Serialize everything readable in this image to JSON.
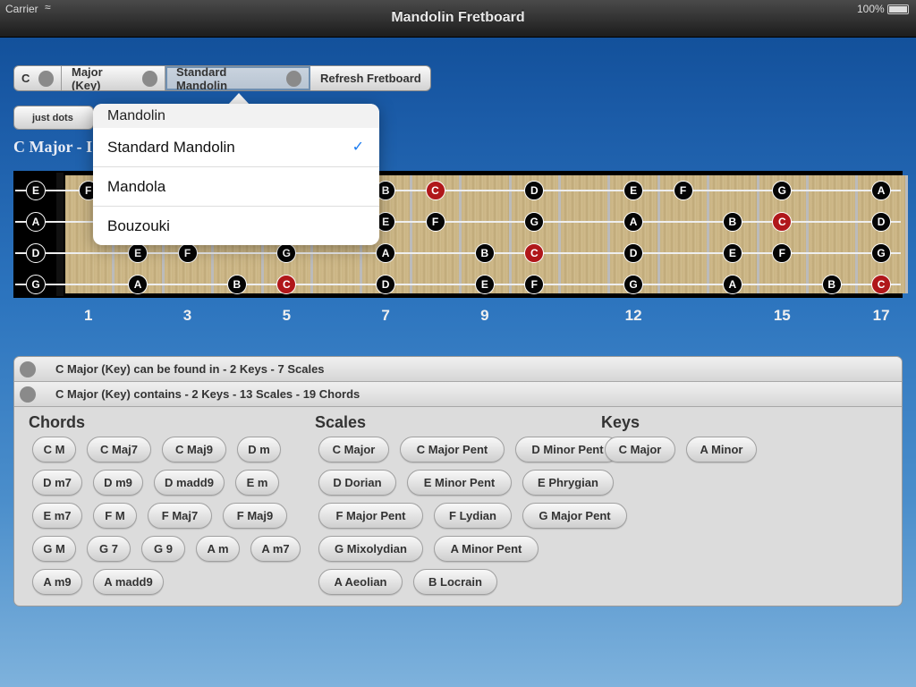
{
  "status": {
    "carrier": "Carrier",
    "battery": "100%"
  },
  "nav": {
    "title": "Mandolin Fretboard"
  },
  "toolbar": {
    "key": "C",
    "mode": "Major (Key)",
    "instrument": "Standard Mandolin",
    "refresh": "Refresh Fretboard",
    "just_dots": "just dots"
  },
  "heading": "C Major - I",
  "strings": [
    "E",
    "A",
    "D",
    "G"
  ],
  "fret_numbers": [
    "1",
    "3",
    "5",
    "7",
    "9",
    "12",
    "15",
    "17"
  ],
  "fretboard_notes": {
    "E": [
      {
        "fret": 1,
        "note": "F",
        "root": false
      },
      {
        "fret": 7,
        "note": "B",
        "root": false
      },
      {
        "fret": 8,
        "note": "C",
        "root": true
      },
      {
        "fret": 10,
        "note": "D",
        "root": false
      },
      {
        "fret": 12,
        "note": "E",
        "root": false
      },
      {
        "fret": 13,
        "note": "F",
        "root": false
      },
      {
        "fret": 15,
        "note": "G",
        "root": false
      },
      {
        "fret": 17,
        "note": "A",
        "root": false
      }
    ],
    "A": [
      {
        "fret": 7,
        "note": "E",
        "root": false
      },
      {
        "fret": 8,
        "note": "F",
        "root": false
      },
      {
        "fret": 10,
        "note": "G",
        "root": false
      },
      {
        "fret": 12,
        "note": "A",
        "root": false
      },
      {
        "fret": 14,
        "note": "B",
        "root": false
      },
      {
        "fret": 15,
        "note": "C",
        "root": true
      },
      {
        "fret": 17,
        "note": "D",
        "root": false
      }
    ],
    "D": [
      {
        "fret": 2,
        "note": "E",
        "root": false
      },
      {
        "fret": 3,
        "note": "F",
        "root": false
      },
      {
        "fret": 5,
        "note": "G",
        "root": false
      },
      {
        "fret": 7,
        "note": "A",
        "root": false
      },
      {
        "fret": 9,
        "note": "B",
        "root": false
      },
      {
        "fret": 10,
        "note": "C",
        "root": true
      },
      {
        "fret": 12,
        "note": "D",
        "root": false
      },
      {
        "fret": 14,
        "note": "E",
        "root": false
      },
      {
        "fret": 15,
        "note": "F",
        "root": false
      },
      {
        "fret": 17,
        "note": "G",
        "root": false
      }
    ],
    "G": [
      {
        "fret": 2,
        "note": "A",
        "root": false
      },
      {
        "fret": 4,
        "note": "B",
        "root": false
      },
      {
        "fret": 5,
        "note": "C",
        "root": true
      },
      {
        "fret": 7,
        "note": "D",
        "root": false
      },
      {
        "fret": 9,
        "note": "E",
        "root": false
      },
      {
        "fret": 10,
        "note": "F",
        "root": false
      },
      {
        "fret": 12,
        "note": "G",
        "root": false
      },
      {
        "fret": 14,
        "note": "A",
        "root": false
      },
      {
        "fret": 16,
        "note": "B",
        "root": false
      },
      {
        "fret": 17,
        "note": "C",
        "root": true
      }
    ]
  },
  "panel": {
    "row1": "C Major (Key) can be found in - 2 Keys - 7 Scales",
    "row2": "C Major (Key) contains - 2 Keys - 13 Scales - 19 Chords",
    "chords_title": "Chords",
    "scales_title": "Scales",
    "keys_title": "Keys",
    "chords": [
      [
        "C M",
        "C Maj7",
        "C Maj9",
        "D m"
      ],
      [
        "D m7",
        "D m9",
        "D madd9",
        "E m"
      ],
      [
        "E m7",
        "F M",
        "F Maj7",
        "F Maj9"
      ],
      [
        "G M",
        "G 7",
        "G 9",
        "A m",
        "A m7"
      ],
      [
        "A m9",
        "A madd9"
      ]
    ],
    "scales": [
      [
        "C Major",
        "C Major Pent",
        "D Minor Pent"
      ],
      [
        "D Dorian",
        "E Minor Pent",
        "E Phrygian"
      ],
      [
        "F Major Pent",
        "F Lydian",
        "G Major Pent"
      ],
      [
        "G Mixolydian",
        "A Minor Pent"
      ],
      [
        "A Aeolian",
        "B Locrain"
      ]
    ],
    "keys": [
      [
        "C Major",
        "A Minor"
      ]
    ]
  },
  "popover": {
    "header": "Mandolin",
    "items": [
      "Standard Mandolin",
      "Mandola",
      "Bouzouki"
    ],
    "selected_index": 0,
    "check": "✓"
  }
}
